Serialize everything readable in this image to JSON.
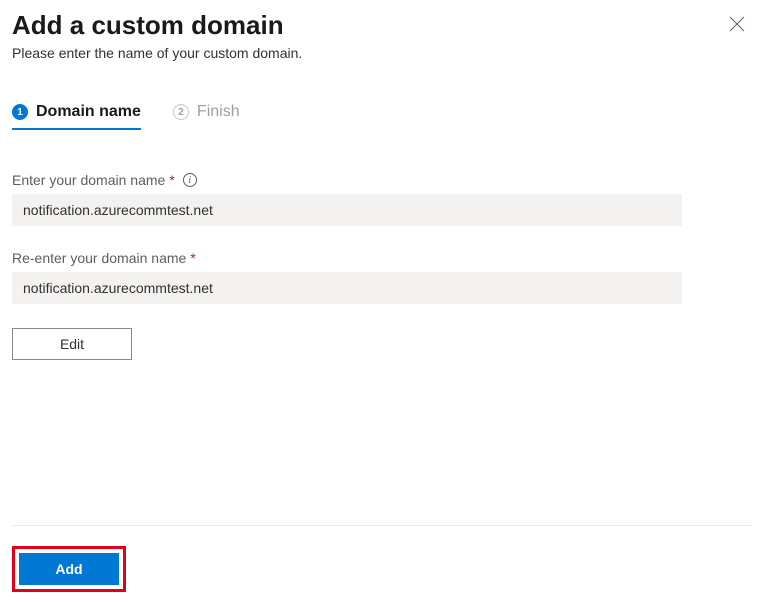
{
  "header": {
    "title": "Add a custom domain",
    "subtitle": "Please enter the name of your custom domain."
  },
  "stepper": {
    "step1_num": "1",
    "step1_label": "Domain name",
    "step2_num": "2",
    "step2_label": "Finish"
  },
  "form": {
    "domain_label": "Enter your domain name",
    "domain_value": "notification.azurecommtest.net",
    "confirm_label": "Re-enter your domain name",
    "confirm_value": "notification.azurecommtest.net",
    "required_mark": "*",
    "info_glyph": "i",
    "edit_label": "Edit"
  },
  "footer": {
    "add_label": "Add"
  }
}
